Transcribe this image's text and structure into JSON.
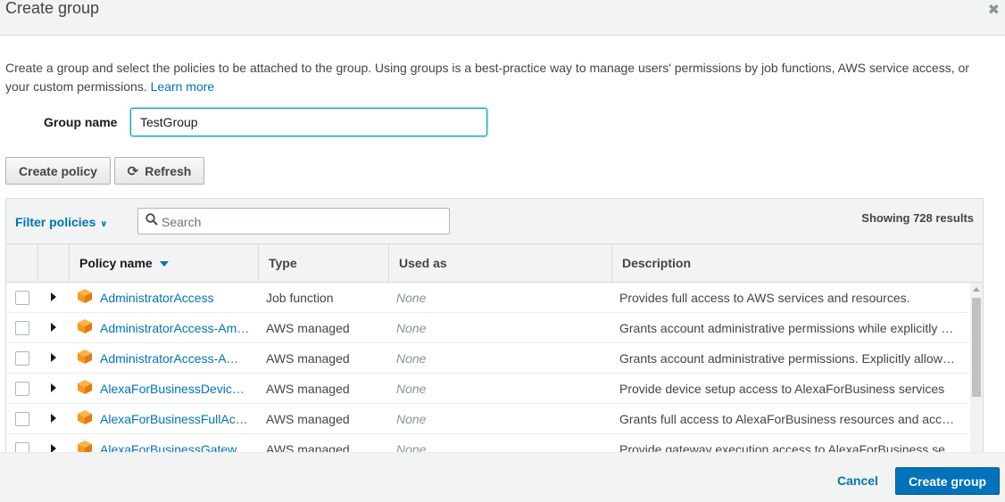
{
  "dialog": {
    "title": "Create group",
    "close_glyph": "✖",
    "close_icon": "close-icon"
  },
  "intro": {
    "text": "Create a group and select the policies to be attached to the group. Using groups is a best-practice way to manage users' permissions by job functions, AWS service access, or your custom permissions.",
    "link": "Learn more"
  },
  "group_name": {
    "label": "Group name",
    "value": "TestGroup"
  },
  "actions": {
    "create_policy": "Create policy",
    "refresh": "Refresh",
    "refresh_icon": "refresh-icon"
  },
  "table": {
    "filter_label": "Filter policies",
    "search_placeholder": "Search",
    "showing": "Showing 728 results",
    "columns": {
      "name": "Policy name",
      "type": "Type",
      "used_as": "Used as",
      "description": "Description"
    },
    "rows": [
      {
        "name": "AdministratorAccess",
        "type": "Job function",
        "used_as": "None",
        "description": "Provides full access to AWS services and resources."
      },
      {
        "name": "AdministratorAccess-Amplify",
        "type": "AWS managed",
        "used_as": "None",
        "description": "Grants account administrative permissions while explicitly allowing direct access to resources needed by Amplify applications."
      },
      {
        "name": "AdministratorAccess-AWSElasticBeanstalk",
        "type": "AWS managed",
        "used_as": "None",
        "description": "Grants account administrative permissions. Explicitly allows developers and administrators to gain direct access to resources."
      },
      {
        "name": "AlexaForBusinessDeviceSetup",
        "type": "AWS managed",
        "used_as": "None",
        "description": "Provide device setup access to AlexaForBusiness services"
      },
      {
        "name": "AlexaForBusinessFullAccess",
        "type": "AWS managed",
        "used_as": "None",
        "description": "Grants full access to AlexaForBusiness resources and access to related AWS Services"
      },
      {
        "name": "AlexaForBusinessGatewayExecution",
        "type": "AWS managed",
        "used_as": "None",
        "description": "Provide gateway execution access to AlexaForBusiness services"
      }
    ]
  },
  "footer": {
    "cancel": "Cancel",
    "create_group": "Create group"
  },
  "colors": {
    "accent": "#0073bb",
    "policy_icon": "#f7981f"
  }
}
